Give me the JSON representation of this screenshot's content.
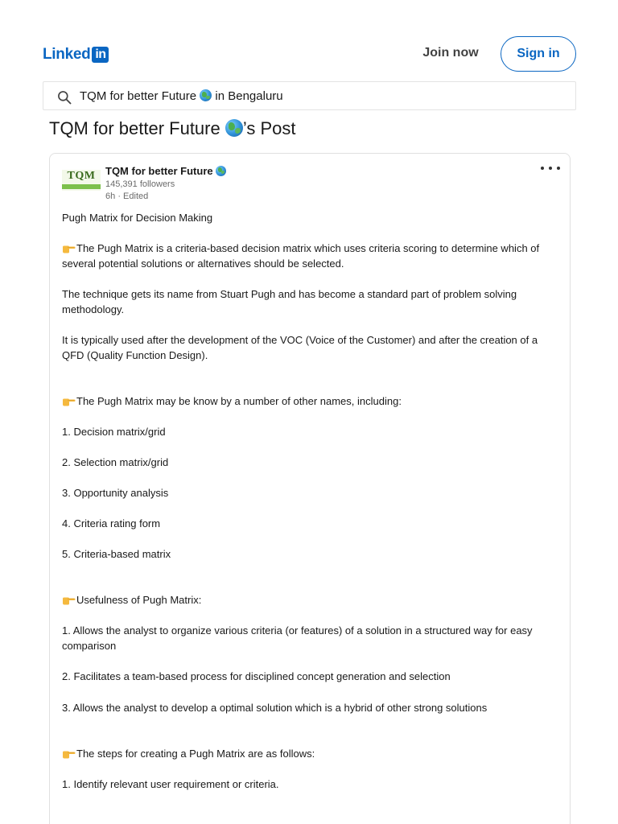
{
  "header": {
    "logo_text": "Linked",
    "logo_box": "in",
    "join_label": "Join now",
    "signin_label": "Sign in"
  },
  "search": {
    "value_prefix": "TQM for better Future",
    "value_suffix": "in Bengaluru"
  },
  "page": {
    "title_prefix": "TQM for better Future",
    "title_suffix": "’s Post"
  },
  "post": {
    "author": {
      "name": "TQM for better Future",
      "avatar_text": "TQM",
      "followers": "145,391 followers",
      "time": "6h",
      "edited": "Edited"
    },
    "lines": [
      "Pugh Matrix for Decision Making",
      "The Pugh Matrix is a criteria-based decision matrix which uses criteria scoring to determine which of several potential solutions or alternatives should be selected.",
      "The technique gets its name from Stuart Pugh and has become a standard part of problem solving methodology.",
      "It is typically used after the development of the VOC (Voice of the Customer) and after the creation of a QFD (Quality Function Design).",
      "The Pugh Matrix may be know by a number of other names, including:",
      "1. Decision matrix/grid",
      "2. Selection matrix/grid",
      "3. Opportunity analysis",
      "4. Criteria rating form",
      "5. Criteria-based matrix",
      "Usefulness of Pugh Matrix:",
      "1. Allows the analyst to organize various criteria (or features) of a solution in a structured way for easy comparison",
      "2. Facilitates a team-based process for disciplined concept generation and selection",
      "3. Allows the analyst to develop a optimal solution which is a hybrid of other strong solutions",
      "The steps for creating a Pugh Matrix are as follows:",
      "1. Identify relevant user requirement or criteria."
    ]
  },
  "colors": {
    "brand": "#0a66c2",
    "text": "#191919",
    "muted": "#666666"
  },
  "icons": {
    "search": "search-icon",
    "globe": "globe-emoji-icon",
    "pointing_hand": "pointing-hand-icon",
    "more": "more-options-icon"
  }
}
